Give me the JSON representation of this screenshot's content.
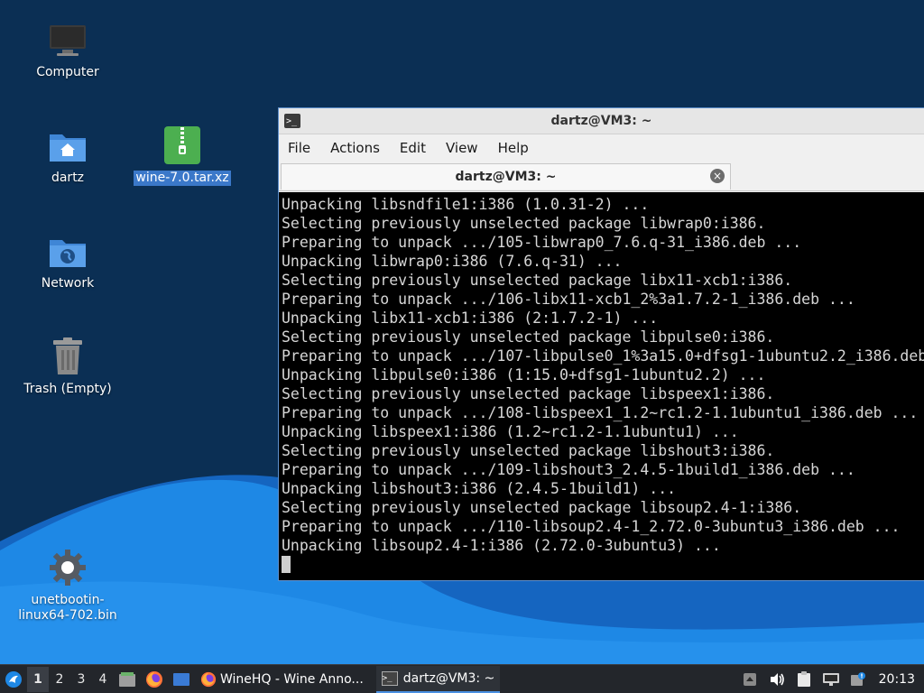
{
  "desktop": {
    "icons": [
      {
        "label": "Computer",
        "icon": "computer-icon"
      },
      {
        "label": "dartz",
        "icon": "home-folder-icon"
      },
      {
        "label": "wine-7.0.tar.xz",
        "icon": "archive-icon",
        "selected": true
      },
      {
        "label": "Network",
        "icon": "network-folder-icon"
      },
      {
        "label": "Trash (Empty)",
        "icon": "trash-icon"
      },
      {
        "label_line1": "unetbootin-",
        "label_line2": "linux64-702.bin",
        "icon": "executable-gear-icon"
      }
    ]
  },
  "terminal": {
    "window_title": "dartz@VM3: ~",
    "menu": [
      "File",
      "Actions",
      "Edit",
      "View",
      "Help"
    ],
    "tab_label": "dartz@VM3: ~",
    "lines": [
      "Unpacking libsndfile1:i386 (1.0.31-2) ...",
      "Selecting previously unselected package libwrap0:i386.",
      "Preparing to unpack .../105-libwrap0_7.6.q-31_i386.deb ...",
      "Unpacking libwrap0:i386 (7.6.q-31) ...",
      "Selecting previously unselected package libx11-xcb1:i386.",
      "Preparing to unpack .../106-libx11-xcb1_2%3a1.7.2-1_i386.deb ...",
      "Unpacking libx11-xcb1:i386 (2:1.7.2-1) ...",
      "Selecting previously unselected package libpulse0:i386.",
      "Preparing to unpack .../107-libpulse0_1%3a15.0+dfsg1-1ubuntu2.2_i386.deb",
      "Unpacking libpulse0:i386 (1:15.0+dfsg1-1ubuntu2.2) ...",
      "Selecting previously unselected package libspeex1:i386.",
      "Preparing to unpack .../108-libspeex1_1.2~rc1.2-1.1ubuntu1_i386.deb ...",
      "Unpacking libspeex1:i386 (1.2~rc1.2-1.1ubuntu1) ...",
      "Selecting previously unselected package libshout3:i386.",
      "Preparing to unpack .../109-libshout3_2.4.5-1build1_i386.deb ...",
      "Unpacking libshout3:i386 (2.4.5-1build1) ...",
      "Selecting previously unselected package libsoup2.4-1:i386.",
      "Preparing to unpack .../110-libsoup2.4-1_2.72.0-3ubuntu3_i386.deb ...",
      "Unpacking libsoup2.4-1:i386 (2.72.0-3ubuntu3) ..."
    ]
  },
  "taskbar": {
    "workspaces": [
      "1",
      "2",
      "3",
      "4"
    ],
    "active_workspace": "1",
    "tasks": [
      {
        "label": "WineHQ - Wine Anno...",
        "icon": "firefox-icon"
      },
      {
        "label": "dartz@VM3: ~",
        "icon": "terminal-icon",
        "active": true
      }
    ],
    "clock": "20:13"
  },
  "colors": {
    "desktop_bg": "#0b2f54",
    "wave_light": "#1e88e5",
    "wave_dark": "#1565c0",
    "selection": "#3b78c9",
    "taskbar_bg": "#23262b"
  }
}
